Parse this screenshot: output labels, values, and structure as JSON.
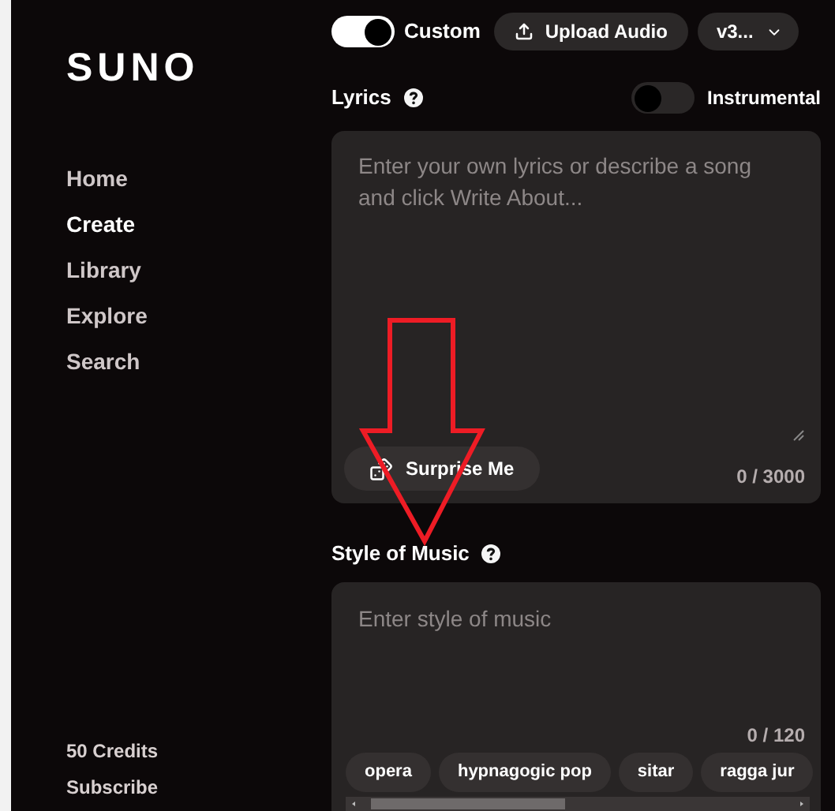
{
  "sidebar": {
    "logo": "SUNO",
    "items": [
      {
        "label": "Home",
        "selected": false
      },
      {
        "label": "Create",
        "selected": true
      },
      {
        "label": "Library",
        "selected": false
      },
      {
        "label": "Explore",
        "selected": false
      },
      {
        "label": "Search",
        "selected": false
      }
    ],
    "credits": "50 Credits",
    "subscribe": "Subscribe"
  },
  "toolbar": {
    "custom": {
      "label": "Custom",
      "on": true
    },
    "upload": "Upload Audio",
    "version": "v3..."
  },
  "lyrics": {
    "label": "Lyrics",
    "instrumental": {
      "label": "Instrumental",
      "on": false
    },
    "placeholder": "Enter your own lyrics or describe a song and click Write About...",
    "surprise": "Surprise Me",
    "counter": "0 / 3000"
  },
  "style": {
    "label": "Style of Music",
    "placeholder": "Enter style of music",
    "counter": "0 / 120",
    "chips": [
      "opera",
      "hypnagogic pop",
      "sitar",
      "ragga jur"
    ]
  },
  "overlay": {
    "kind": "arrow"
  }
}
